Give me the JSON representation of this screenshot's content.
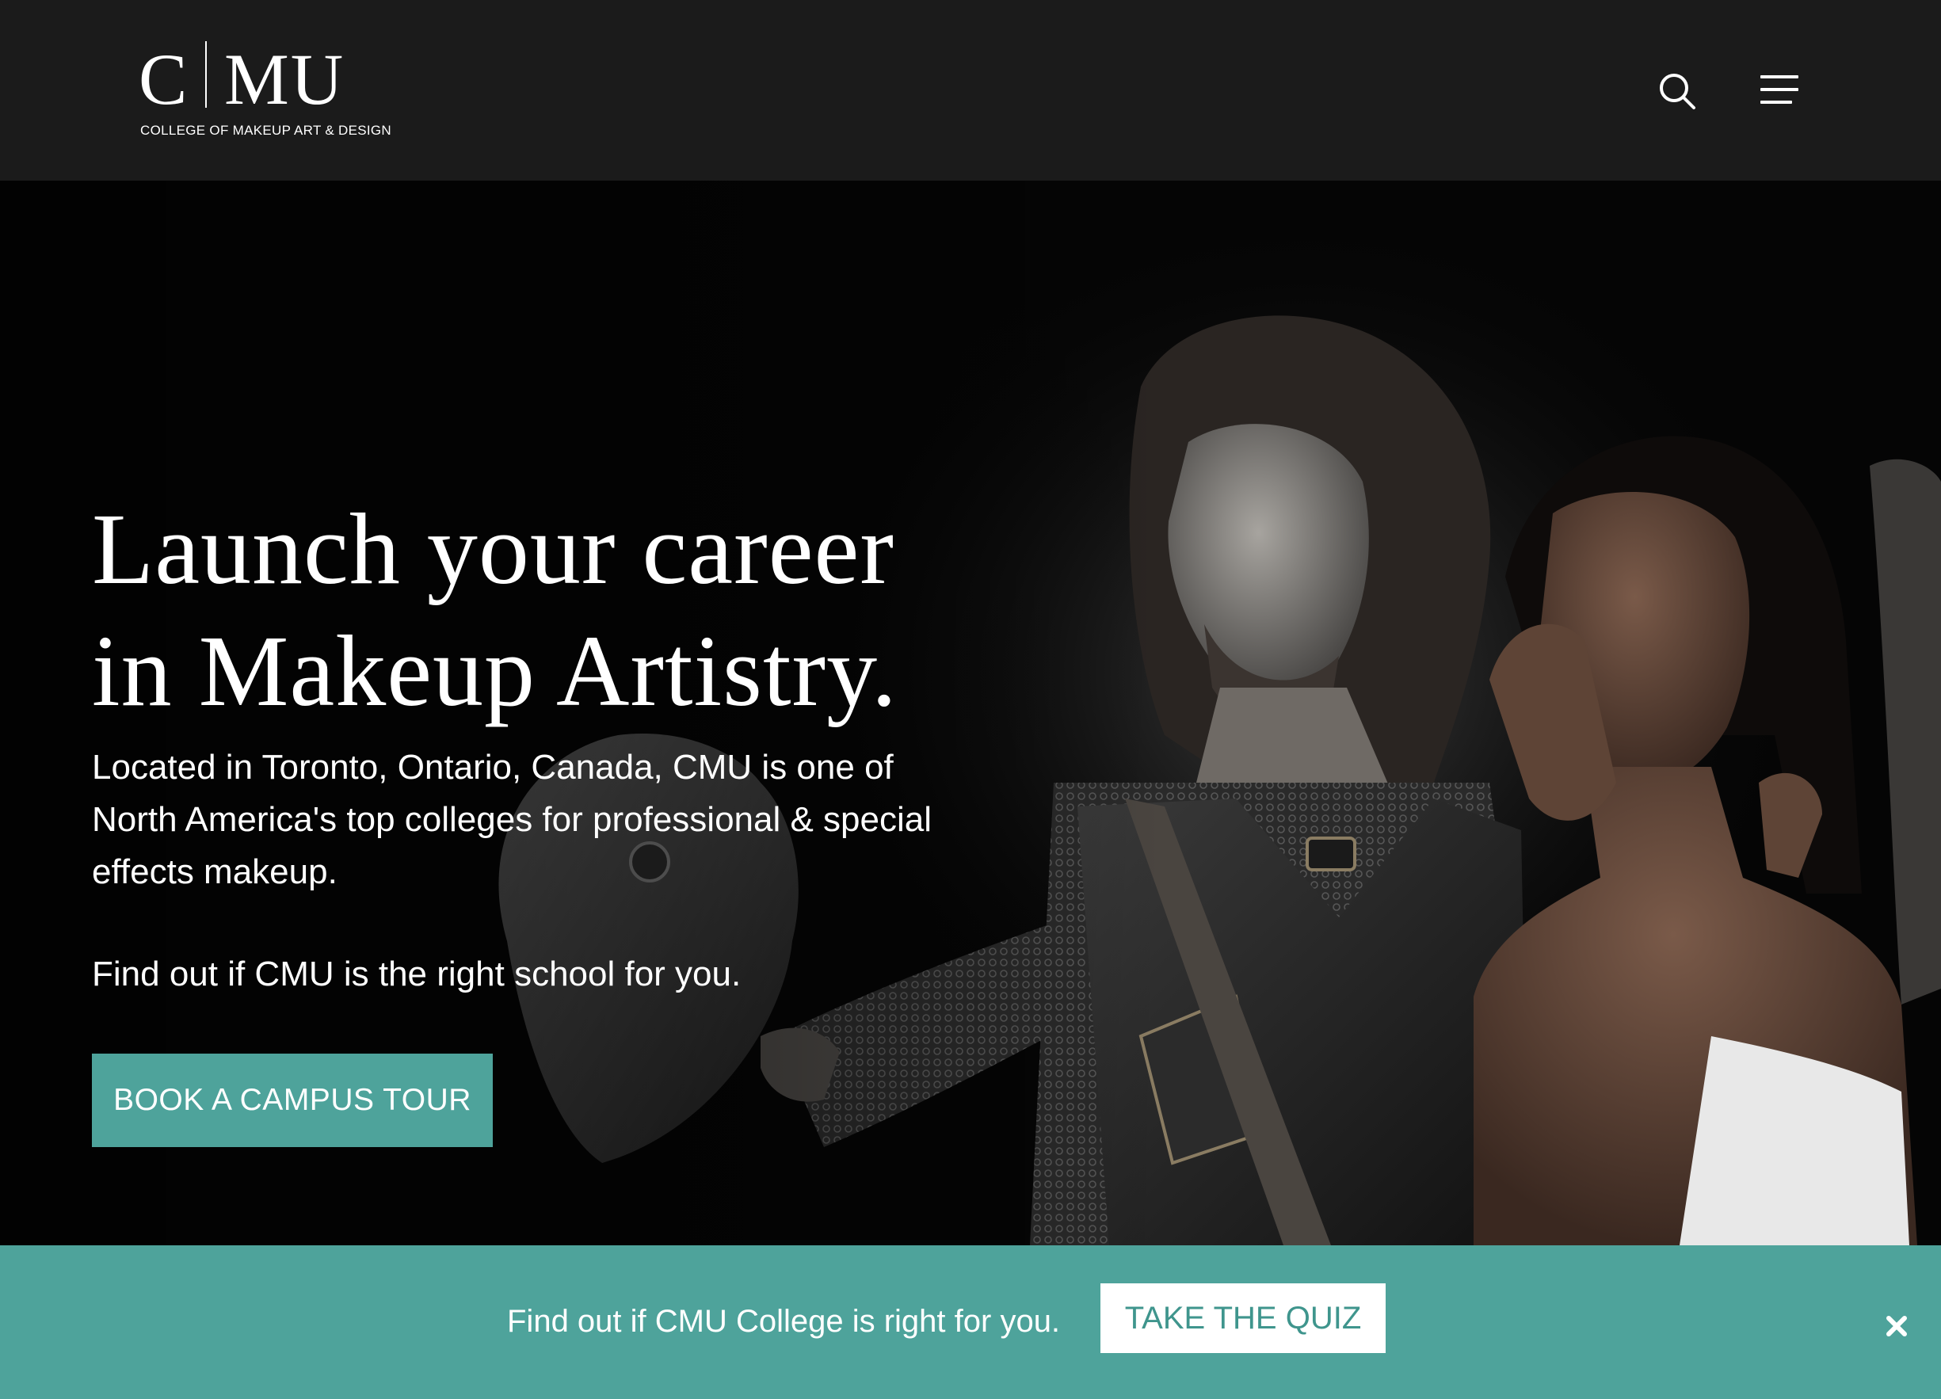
{
  "header": {
    "logo": {
      "letter_c": "C",
      "letters_mu": "MU",
      "subtitle": "COLLEGE OF MAKEUP ART & DESIGN"
    },
    "search_icon": "search-icon",
    "menu_icon": "hamburger-menu-icon"
  },
  "hero": {
    "title_line1": "Launch your career",
    "title_line2": "in Makeup Artistry.",
    "description": "Located in Toronto, Ontario, Canada, CMU is one of North America's top colleges for professional & special effects makeup.",
    "cta_text": "Find out if CMU is the right school for you.",
    "tour_button": "BOOK A CAMPUS TOUR"
  },
  "quiz_bar": {
    "text": "Find out if CMU College is right for you.",
    "button": "TAKE THE QUIZ",
    "close_icon": "close-icon"
  },
  "colors": {
    "header_bg": "#1b1b1b",
    "accent_teal": "#4ea39b",
    "quiz_button_text": "#3f958d",
    "hero_bg": "#050505"
  }
}
